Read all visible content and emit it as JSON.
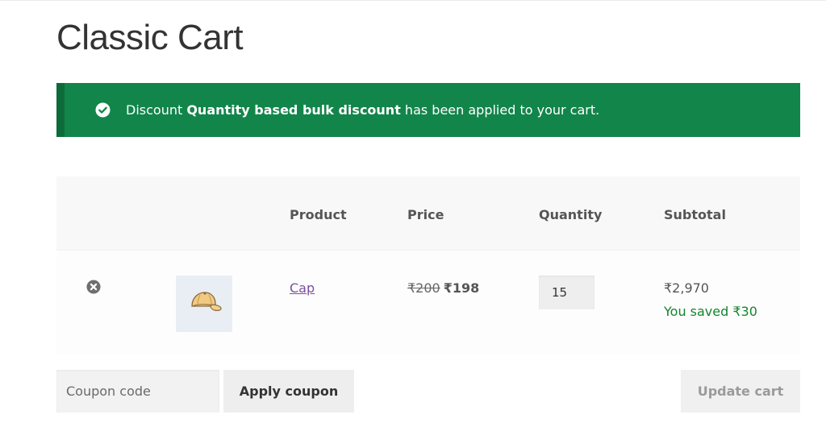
{
  "page": {
    "title": "Classic Cart"
  },
  "notice": {
    "prefix": "Discount ",
    "discount_name": "Quantity based bulk discount",
    "suffix": " has been applied to your cart.",
    "icon": "check-circle-icon",
    "color": "#12854a"
  },
  "table": {
    "headers": {
      "product": "Product",
      "price": "Price",
      "quantity": "Quantity",
      "subtotal": "Subtotal"
    },
    "rows": [
      {
        "remove_icon": "close-circle-icon",
        "thumbnail_icon": "cap-icon",
        "product_name": "Cap",
        "regular_price": "₹200",
        "sale_price": "₹198",
        "quantity": "15",
        "subtotal": "₹2,970",
        "savings": "You saved ₹30"
      }
    ]
  },
  "actions": {
    "coupon_placeholder": "Coupon code",
    "apply_coupon_label": "Apply coupon",
    "update_cart_label": "Update cart"
  },
  "colors": {
    "link": "#7d4ea0",
    "saved_text": "#12852c"
  }
}
